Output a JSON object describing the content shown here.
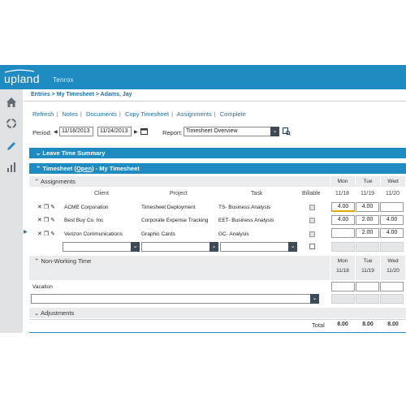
{
  "header": {
    "logo": "upland",
    "product": "Tenrox"
  },
  "breadcrumb": [
    "Entries",
    "My Timesheet",
    "Adams, Jay"
  ],
  "actions": [
    "Refresh",
    "Notes",
    "Documents",
    "Copy Timesheet",
    "Assignments",
    "Complete"
  ],
  "period": {
    "label": "Period:",
    "start": "11/18/2013",
    "end": "11/24/2013"
  },
  "report": {
    "label": "Report:",
    "value": "Timesheet Overview"
  },
  "leave_summary": {
    "title": "Leave Time Summary"
  },
  "timesheet_bar": {
    "prefix": "Timesheet (",
    "status": "Open",
    "suffix": ") - My Timesheet"
  },
  "assignments": {
    "title": "Assignments",
    "columns": {
      "client": "Client",
      "project": "Project",
      "task": "Task",
      "billable": "Billable"
    },
    "days": [
      {
        "day": "Mon",
        "date": "11/18"
      },
      {
        "day": "Tue",
        "date": "11/19"
      },
      {
        "day": "Wed",
        "date": "11/20"
      }
    ],
    "rows": [
      {
        "client": "ACME Corporation",
        "project": "Timesheet Deployment",
        "task": "TS- Business Analysis",
        "mon": "4.00",
        "tue": "4.00",
        "wed": ""
      },
      {
        "client": "Best Buy Co. Inc",
        "project": "Corporate Expense Tracking",
        "task": "EET- Business Analysis",
        "mon": "4.00",
        "tue": "2.00",
        "wed": "4.00"
      },
      {
        "client": "Verizon Communications",
        "project": "Graphic Cards",
        "task": "GC- Analysis",
        "mon": "",
        "tue": "2.00",
        "wed": "4.00"
      }
    ]
  },
  "non_working": {
    "title": "Non-Working Time",
    "days": [
      {
        "day": "Mon",
        "date": "11/18"
      },
      {
        "day": "Tue",
        "date": "11/19"
      },
      {
        "day": "Wed",
        "date": "11/20"
      }
    ],
    "vacation_label": "Vacation"
  },
  "adjustments": {
    "title": "Adjustments"
  },
  "totals": {
    "label": "Total",
    "mon": "8.00",
    "tue": "8.00",
    "wed": "8.00"
  },
  "colors": {
    "brand": "#1e8bc3",
    "nav": "#dfe1e3",
    "link": "#1f6fa7"
  }
}
